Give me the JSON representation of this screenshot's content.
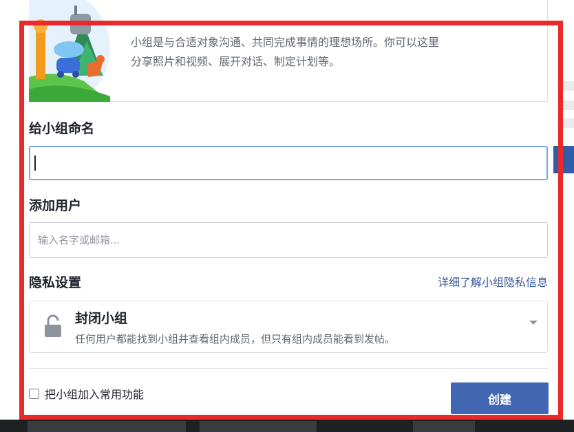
{
  "intro": {
    "line1": "小组是与合适对象沟通、共同完成事情的理想场所。你可以这里",
    "line2": "分享照片和视频、展开对话、制定计划等。"
  },
  "name_section": {
    "title": "给小组命名",
    "value": ""
  },
  "add_users": {
    "title": "添加用户",
    "placeholder": "输入名字或邮箱..."
  },
  "privacy": {
    "title": "隐私设置",
    "learn_more": "详细了解小组隐私信息",
    "selected_title": "封闭小组",
    "selected_desc": "任何用户都能找到小组并查看组内成员，但只有组内成员能看到发帖。"
  },
  "footer": {
    "favorite_label": "把小组加入常用功能",
    "favorite_checked": false,
    "create_label": "创建"
  },
  "colors": {
    "highlight_frame": "#ea2a2a",
    "primary_button": "#4267b2",
    "link": "#385898",
    "focus_border": "#7aa7e3"
  }
}
